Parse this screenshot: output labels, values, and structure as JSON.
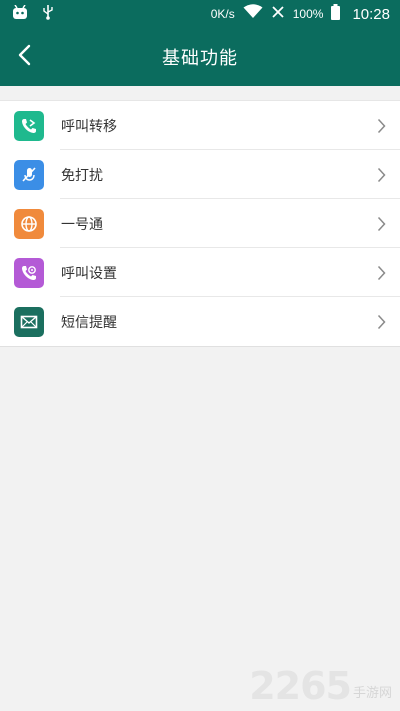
{
  "status_bar": {
    "speed": "0K/s",
    "battery": "100%",
    "time": "10:28"
  },
  "header": {
    "title": "基础功能"
  },
  "menu": {
    "items": [
      {
        "label": "呼叫转移",
        "icon": "call-forward-icon",
        "color": "#1fb98e"
      },
      {
        "label": "免打扰",
        "icon": "do-not-disturb-icon",
        "color": "#3b8ee6"
      },
      {
        "label": "一号通",
        "icon": "globe-icon",
        "color": "#f08a3c"
      },
      {
        "label": "呼叫设置",
        "icon": "call-settings-icon",
        "color": "#b45ad6"
      },
      {
        "label": "短信提醒",
        "icon": "mail-icon",
        "color": "#1b6f5f"
      }
    ]
  },
  "watermark": {
    "number": "2265",
    "text": "手游网"
  },
  "colors": {
    "primary": "#0b6c5e",
    "background": "#f2f2f2"
  }
}
